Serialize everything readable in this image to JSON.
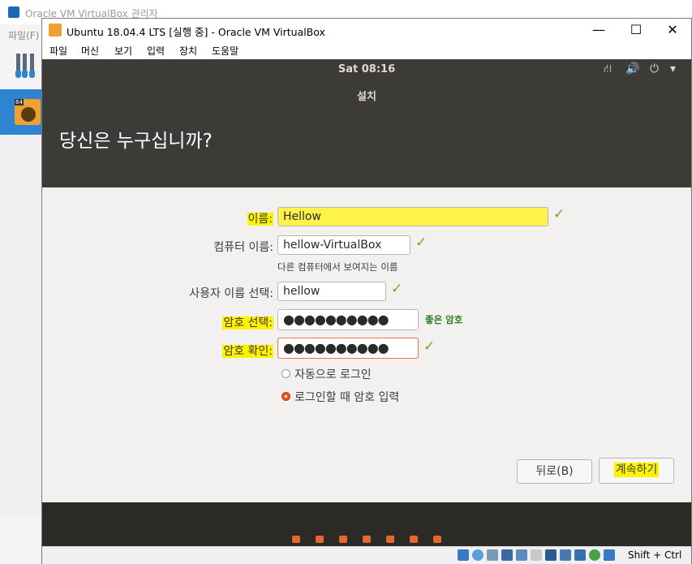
{
  "manager": {
    "title": "Oracle VM VirtualBox 관리자",
    "menu_file": "파일(F)",
    "vm_badge": "64"
  },
  "vm_window": {
    "title": "Ubuntu 18.04.4 LTS [실행 중] - Oracle VM VirtualBox",
    "controls": {
      "minimize": "—",
      "maximize": "☐",
      "close": "✕"
    },
    "menu": [
      "파일",
      "머신",
      "보기",
      "입력",
      "장치",
      "도움말"
    ]
  },
  "guest": {
    "clock": "Sat 08:16",
    "tray": {
      "network": "⛙",
      "volume": "🔊",
      "power": "⏻",
      "menu": "▾"
    }
  },
  "installer": {
    "window_title": "설치",
    "heading": "당신은 누구십니까?",
    "fields": {
      "name": {
        "label": "이름:",
        "value": "Hellow",
        "check": "✓"
      },
      "computer": {
        "label": "컴퓨터 이름:",
        "value": "hellow-VirtualBox",
        "check": "✓",
        "hint": "다른 컴퓨터에서 보여지는 이름"
      },
      "username": {
        "label": "사용자 이름 선택:",
        "value": "hellow",
        "check": "✓"
      },
      "password": {
        "label": "암호 선택:",
        "value": "●●●●●●●●●●",
        "strength": "좋은 암호"
      },
      "confirm": {
        "label": "암호 확인:",
        "value": "●●●●●●●●●●",
        "check": "✓"
      }
    },
    "login_options": {
      "auto": "자동으로 로그인",
      "require": "로그인할 때 암호 입력",
      "selected": "require"
    },
    "buttons": {
      "back": "뒤로(B)",
      "continue": "계속하기"
    },
    "progress_dots": 7
  },
  "statusbar": {
    "host_key": "Shift + Ctrl"
  },
  "colors": {
    "ubuntu_orange": "#e95420",
    "header_dark": "#3c3b37",
    "highlight": "#fff200",
    "check_green": "#73a820"
  }
}
